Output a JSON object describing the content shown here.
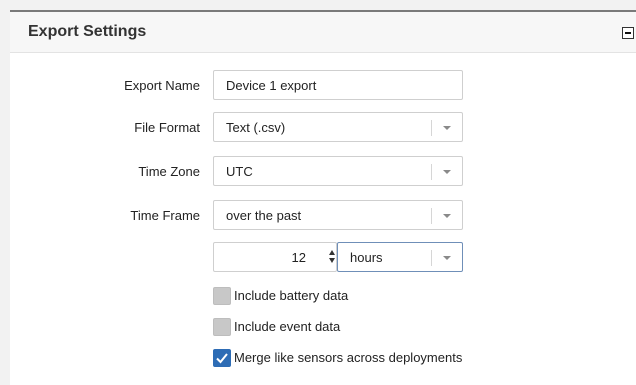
{
  "panel": {
    "title": "Export Settings"
  },
  "form": {
    "export_name": {
      "label": "Export Name",
      "value": "Device 1 export"
    },
    "file_format": {
      "label": "File Format",
      "value": "Text (.csv)"
    },
    "time_zone": {
      "label": "Time Zone",
      "value": "UTC"
    },
    "time_frame": {
      "label": "Time Frame",
      "value": "over the past",
      "amount": "12",
      "unit": "hours"
    }
  },
  "options": {
    "battery": {
      "label": "Include battery data",
      "checked": false
    },
    "event": {
      "label": "Include event data",
      "checked": false
    },
    "merge": {
      "label": "Merge like sensors across deployments",
      "checked": true
    }
  },
  "colors": {
    "accent": "#2d6cb5",
    "unchecked": "#c8c8c8"
  },
  "icons": {
    "collapse": "minus-icon",
    "dropdown": "caret-down-icon",
    "spinner": "up-down-arrows-icon",
    "check": "checkmark-icon"
  }
}
